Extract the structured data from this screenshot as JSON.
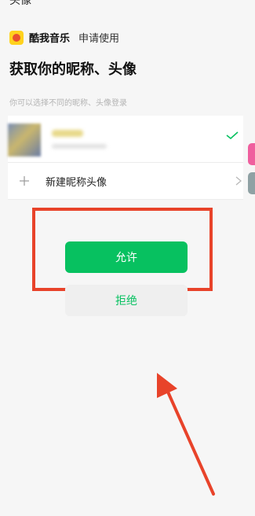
{
  "header": {
    "fragment_text": "头像"
  },
  "app": {
    "name": "酷我音乐",
    "request_text": "申请使用",
    "logo_icon": "kuwo-logo-icon"
  },
  "page": {
    "title": "获取你的昵称、头像",
    "hint": "你可以选择不同的昵称、头像登录"
  },
  "accounts": {
    "selected": true,
    "check_icon": "check-icon",
    "new_label": "新建昵称头像",
    "plus_icon": "plus-icon",
    "chevron_icon": "chevron-right-icon"
  },
  "actions": {
    "allow_label": "允许",
    "reject_label": "拒绝"
  },
  "colors": {
    "accent_green": "#07c160",
    "annotation_red": "#e8432a"
  }
}
